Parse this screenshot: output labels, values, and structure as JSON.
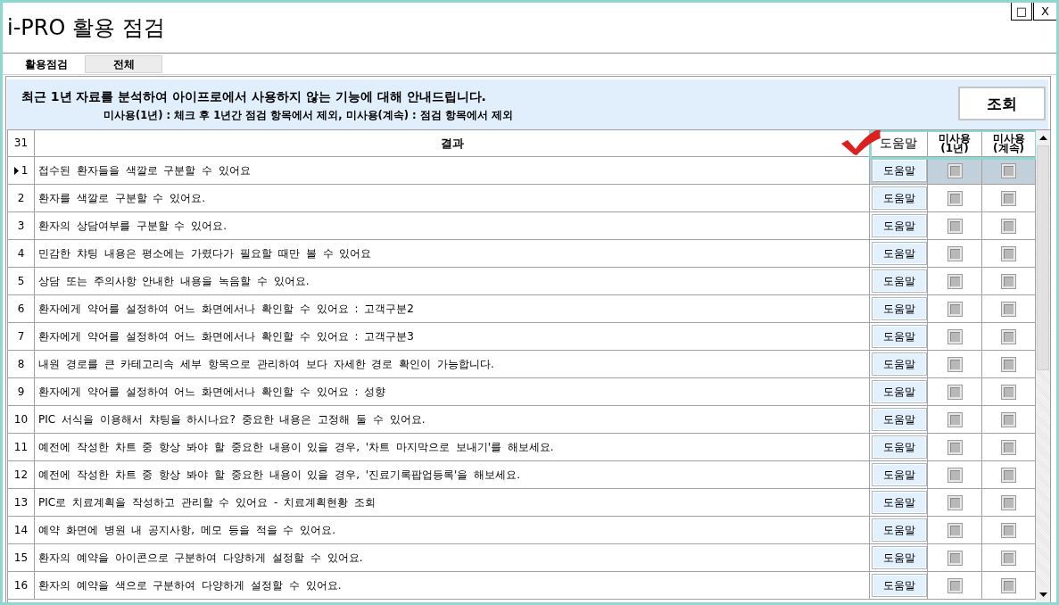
{
  "window": {
    "title": "i-PRO 활용 점검",
    "controls": [
      {
        "kind": "maximize",
        "label": "□"
      },
      {
        "kind": "close",
        "label": "X"
      }
    ]
  },
  "tabs": [
    {
      "label": "활용점검",
      "selected": true
    },
    {
      "label": "전체",
      "selected": false
    }
  ],
  "notice": {
    "heading": "최근 1년 자료를 분석하여 아이프로에서 사용하지 않는 기능에 대해 안내드립니다.",
    "note": "미사용(1년) : 체크 후 1년간 점검 항목에서 제외, 미사용(계속) : 점검 항목에서 제외"
  },
  "query_button": "조회",
  "table": {
    "row_count": "31",
    "check_mark": true,
    "columns": [
      {
        "label": "결과",
        "highlighted": false
      },
      {
        "label": "도움말",
        "highlighted": true
      },
      {
        "label": "미사용\n(1년)",
        "highlighted": true
      },
      {
        "label": "미사용\n(계속)",
        "highlighted": true
      }
    ],
    "rows": [
      {
        "number": "1",
        "text": "접수된 환자들을 색깔로 구분할 수 있어요",
        "help": "도움말",
        "unused_1y": false,
        "unused_ongoing": false,
        "selected": true
      },
      {
        "number": "2",
        "text": "환자를 색깔로 구분할 수 있어요.",
        "help": "도움말",
        "unused_1y": false,
        "unused_ongoing": false,
        "selected": false
      },
      {
        "number": "3",
        "text": "환자의 상담여부를 구분할 수 있어요.",
        "help": "도움말",
        "unused_1y": false,
        "unused_ongoing": false,
        "selected": false
      },
      {
        "number": "4",
        "text": "민감한 챠팅 내용은 평소에는 가렸다가 필요할 때만 볼 수 있어요",
        "help": "도움말",
        "unused_1y": false,
        "unused_ongoing": false,
        "selected": false
      },
      {
        "number": "5",
        "text": "상담 또는 주의사항 안내한 내용을 녹음할 수 있어요.",
        "help": "도움말",
        "unused_1y": false,
        "unused_ongoing": false,
        "selected": false
      },
      {
        "number": "6",
        "text": "환자에게 약어를 설정하여 어느 화면에서나 확인할 수 있어요 : 고객구분2",
        "help": "도움말",
        "unused_1y": false,
        "unused_ongoing": false,
        "selected": false
      },
      {
        "number": "7",
        "text": "환자에게 약어를 설정하여 어느 화면에서나 확인할 수 있어요 : 고객구분3",
        "help": "도움말",
        "unused_1y": false,
        "unused_ongoing": false,
        "selected": false
      },
      {
        "number": "8",
        "text": "내원 경로를 큰 카테고리속 세부 항목으로 관리하여 보다 자세한 경로 확인이 가능합니다.",
        "help": "도움말",
        "unused_1y": false,
        "unused_ongoing": false,
        "selected": false
      },
      {
        "number": "9",
        "text": "환자에게 약어를 설정하여 어느 화면에서나 확인할 수 있어요 : 성향",
        "help": "도움말",
        "unused_1y": false,
        "unused_ongoing": false,
        "selected": false
      },
      {
        "number": "10",
        "text": "PIC 서식을 이용해서 챠팅을 하시나요? 중요한 내용은 고정해 둘 수 있어요.",
        "help": "도움말",
        "unused_1y": false,
        "unused_ongoing": false,
        "selected": false
      },
      {
        "number": "11",
        "text": "예전에 작성한 차트 중 항상 봐야 할 중요한 내용이 있을 경우, '차트 마지막으로 보내기'를 해보세요.",
        "help": "도움말",
        "unused_1y": false,
        "unused_ongoing": false,
        "selected": false
      },
      {
        "number": "12",
        "text": "예전에 작성한 차트 중 항상 봐야 할 중요한 내용이 있을 경우, '진료기록팝업등록'을 해보세요.",
        "help": "도움말",
        "unused_1y": false,
        "unused_ongoing": false,
        "selected": false
      },
      {
        "number": "13",
        "text": "PIC로 치료계획을 작성하고 관리할 수 있어요 - 치료계획현황 조회",
        "help": "도움말",
        "unused_1y": false,
        "unused_ongoing": false,
        "selected": false
      },
      {
        "number": "14",
        "text": "예약 화면에 병원 내 공지사항, 메모 등을 적을 수 있어요.",
        "help": "도움말",
        "unused_1y": false,
        "unused_ongoing": false,
        "selected": false
      },
      {
        "number": "15",
        "text": "환자의 예약을 아이콘으로 구분하여 다양하게 설정할 수 있어요.",
        "help": "도움말",
        "unused_1y": false,
        "unused_ongoing": false,
        "selected": false
      },
      {
        "number": "16",
        "text": "환자의 예약을 색으로 구분하여 다양하게 설정할 수 있어요.",
        "help": "도움말",
        "unused_1y": false,
        "unused_ongoing": false,
        "selected": false
      }
    ]
  }
}
